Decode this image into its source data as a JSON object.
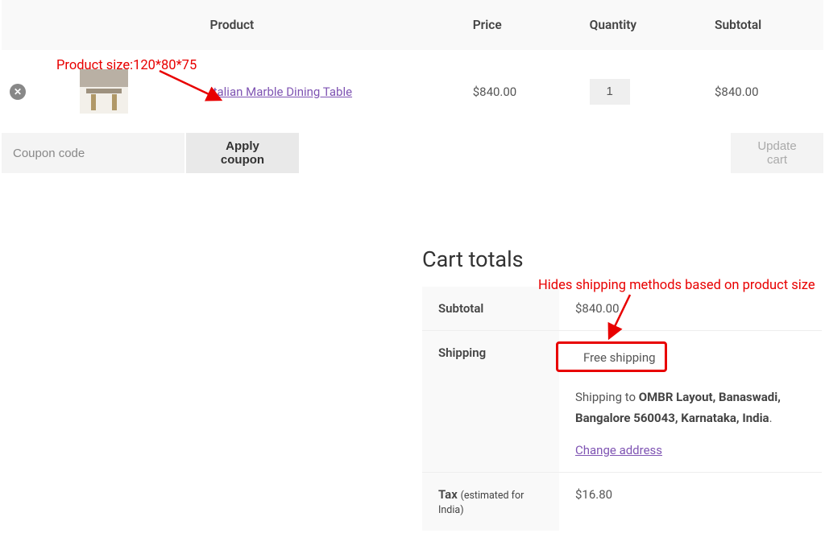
{
  "table": {
    "head": {
      "product": "Product",
      "price": "Price",
      "qty": "Quantity",
      "subtotal": "Subtotal"
    },
    "row": {
      "name": "Italian Marble Dining Table",
      "price": "$840.00",
      "qty": "1",
      "subtotal": "$840.00"
    }
  },
  "actions": {
    "coupon_placeholder": "Coupon code",
    "apply": "Apply coupon",
    "update": "Update cart"
  },
  "totals": {
    "heading": "Cart totals",
    "subtotal_label": "Subtotal",
    "subtotal": "$840.00",
    "shipping_label": "Shipping",
    "shipping_method": "Free shipping",
    "ship_to_prefix": "Shipping to ",
    "ship_to_addr": "OMBR Layout, Banaswadi, Bangalore 560043, Karnataka, India",
    "change_addr": "Change address",
    "tax_label": "Tax ",
    "tax_note": "(estimated for India)",
    "tax": "$16.80"
  },
  "annotations": {
    "size": "Product size:120*80*75",
    "hides": "Hides shipping methods based on product size"
  }
}
